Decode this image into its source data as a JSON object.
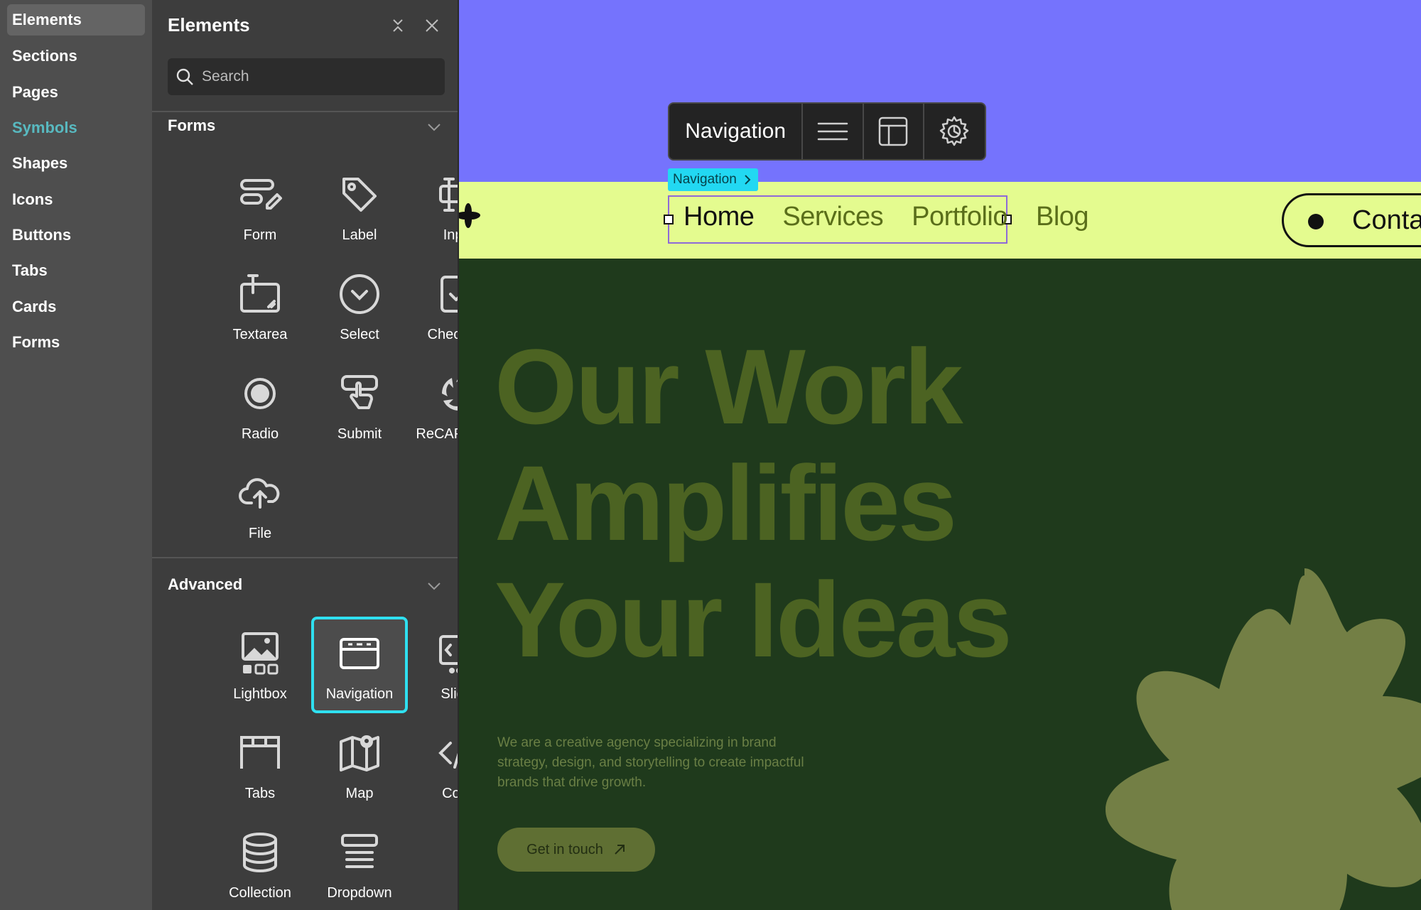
{
  "rail": {
    "items": [
      {
        "label": "Elements"
      },
      {
        "label": "Sections"
      },
      {
        "label": "Pages"
      },
      {
        "label": "Symbols"
      },
      {
        "label": "Shapes"
      },
      {
        "label": "Icons"
      },
      {
        "label": "Buttons"
      },
      {
        "label": "Tabs"
      },
      {
        "label": "Cards"
      },
      {
        "label": "Forms"
      }
    ],
    "active": "Elements",
    "accent_item": "Symbols",
    "accent_color": "#58b9c0"
  },
  "panel": {
    "title": "Elements",
    "search_placeholder": "Search",
    "forms": {
      "heading": "Forms",
      "items": [
        {
          "label": "Form",
          "icon": "form-icon"
        },
        {
          "label": "Label",
          "icon": "tag-icon"
        },
        {
          "label": "Input",
          "icon": "input-icon"
        },
        {
          "label": "Textarea",
          "icon": "textarea-icon"
        },
        {
          "label": "Select",
          "icon": "select-icon"
        },
        {
          "label": "Checkbox",
          "icon": "checkbox-icon"
        },
        {
          "label": "Radio",
          "icon": "radio-icon"
        },
        {
          "label": "Submit",
          "icon": "submit-icon"
        },
        {
          "label": "ReCAPTCHA",
          "icon": "recaptcha-icon"
        },
        {
          "label": "File",
          "icon": "cloud-upload-icon"
        }
      ]
    },
    "advanced": {
      "heading": "Advanced",
      "items": [
        {
          "label": "Lightbox",
          "icon": "lightbox-icon"
        },
        {
          "label": "Navigation",
          "icon": "navigation-icon"
        },
        {
          "label": "Slider",
          "icon": "slider-icon"
        },
        {
          "label": "Tabs",
          "icon": "tabs-icon"
        },
        {
          "label": "Map",
          "icon": "map-icon"
        },
        {
          "label": "Code",
          "icon": "code-icon"
        },
        {
          "label": "Collection",
          "icon": "database-icon"
        },
        {
          "label": "Dropdown",
          "icon": "dropdown-icon"
        }
      ],
      "selected": "Navigation",
      "selected_color": "#2fe0f0"
    }
  },
  "canvas": {
    "toolbar": {
      "label": "Navigation"
    },
    "selection_tag": "Navigation",
    "nav_links": [
      "Home",
      "Services",
      "Portfolio",
      "Blog"
    ],
    "contact_label": "Conta",
    "headline": [
      "Our Work",
      "Amplifies",
      "Your Ideas"
    ],
    "blurb": "We are a creative agency specializing in brand strategy, design, and storytelling to create impactful brands that drive growth.",
    "cta_label": "Get in touch",
    "colors": {
      "hero_top": "#7573fd",
      "navbar": "#e4fb8f",
      "body": "#1f3a1c",
      "headline": "#4c6322",
      "flower": "#737f45"
    }
  }
}
